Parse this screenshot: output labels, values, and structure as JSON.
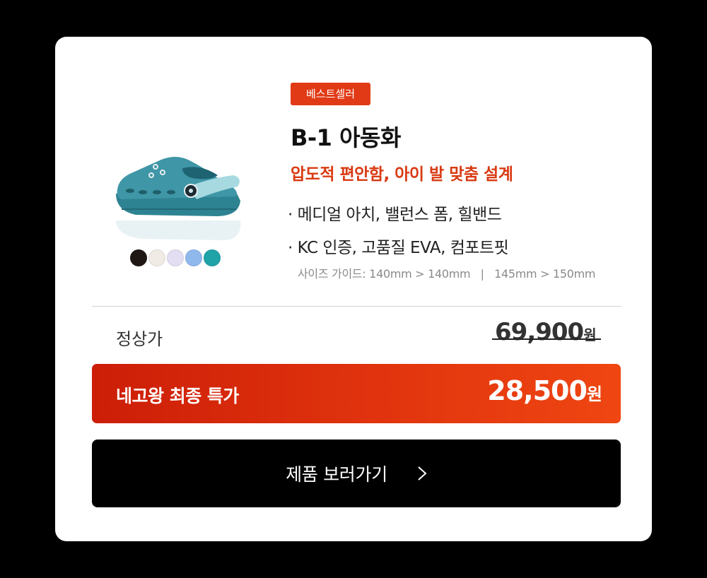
{
  "product": {
    "badge": "베스트셀러",
    "title": "B-1 아동화",
    "subtitle": "압도적 편안함, 아이 발 맞춤 설계",
    "features": [
      "· 메디얼 아치, 밸런스 폼, 힐밴드",
      "· KC 인증, 고품질 EVA, 컴포트핏"
    ],
    "size_guide": "사이즈 가이드: 140mm > 140mm   |   145mm > 150mm",
    "image_icon": "clog-shoe-image",
    "image_color": "#3e96a6",
    "strap_color": "#a7d9e0",
    "swatches": [
      "#1f1714",
      "#f1ebe6",
      "#e4def2",
      "#8fb8ec",
      "#1fa3a8"
    ]
  },
  "pricing": {
    "regular_label": "정상가",
    "regular_price": "69,900",
    "regular_unit": "원",
    "final_label": "네고왕 최종 특가",
    "final_price": "28,500",
    "final_unit": "원",
    "accent": "#e13a16"
  },
  "cta": {
    "label": "제품 보러가기",
    "icon": "chevron-right-icon"
  }
}
